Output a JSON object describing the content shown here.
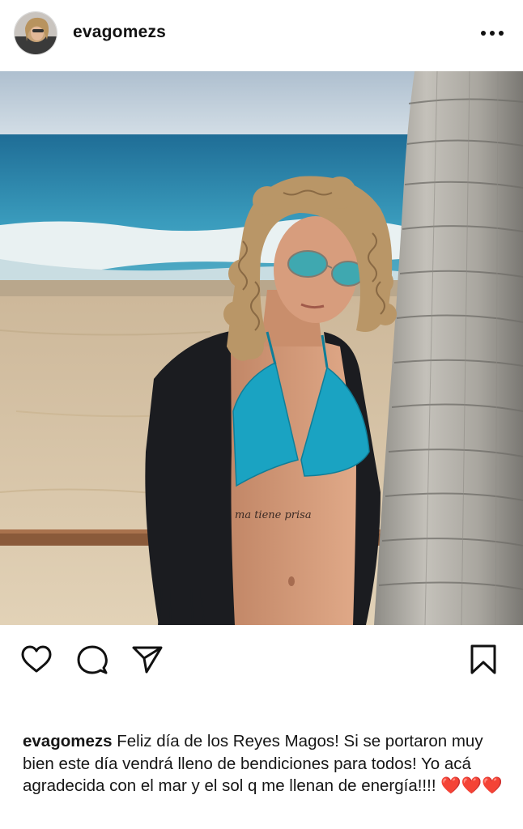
{
  "post": {
    "username": "evagomezs",
    "caption_user": "evagomezs",
    "caption_text": "Feliz día de los Reyes Magos! Si se portaron muy bien este día vendrá lleno de bendiciones para todos! Yo acá agradecida con el mar y el sol q me llenan de energía!!!! ❤️❤️❤️",
    "tattoo_text": "ma tiene prisa"
  },
  "icons": {
    "more": "more-horizontal-icon",
    "like": "heart-icon",
    "comment": "comment-bubble-icon",
    "share": "paper-plane-icon",
    "save": "bookmark-icon"
  },
  "colors": {
    "icon": "#111111",
    "text": "#161616",
    "bikini": "#1aa3c2",
    "sea": "#2d8cae",
    "sand": "#d9c4a4"
  }
}
